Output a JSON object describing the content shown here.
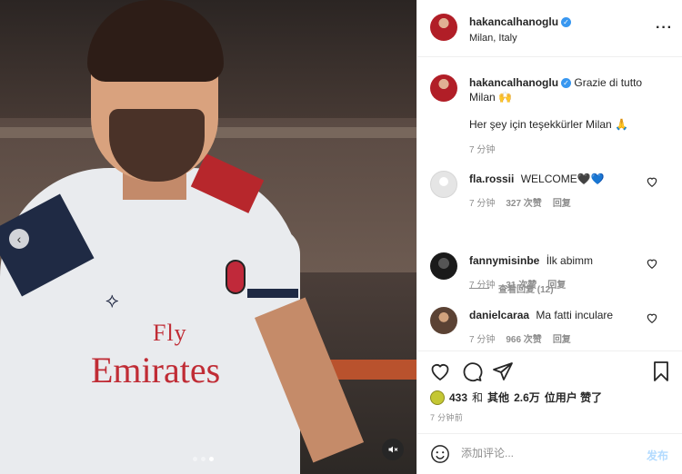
{
  "post": {
    "author": "hakancalhanoglu",
    "location": "Milan, Italy",
    "more_icon": "more-horizontal-icon"
  },
  "media": {
    "sponsor_top": "Fly",
    "sponsor_main": "Emirates",
    "dots": [
      false,
      false,
      true
    ]
  },
  "caption": {
    "username": "hakancalhanoglu",
    "text": "Grazie di tutto Milan 🙌",
    "text_line2": "Her şey için teşekkürler Milan 🙏",
    "time": "7 分钟"
  },
  "comments": [
    {
      "username": "fla.rossii",
      "text": "WELCOME🖤💙",
      "time": "7 分钟",
      "likes": "327 次赞",
      "reply": "回复"
    },
    {
      "username": "fannymisinbe",
      "text": "İlk abimm",
      "time": "7 分钟",
      "likes": "31 次赞",
      "reply": "回复"
    },
    {
      "username": "danielcaraa",
      "text": "Ma fatti inculare",
      "time": "7 分钟",
      "likes": "966 次赞",
      "reply": "回复"
    }
  ],
  "view_replies": "查看回复 (12)",
  "likes": {
    "count": "433",
    "connector": "和",
    "others_label": "其他",
    "others_count": "2.6万",
    "suffix": "位用户 赞了"
  },
  "post_time": "7 分钟前",
  "add_comment": {
    "placeholder": "添加评论...",
    "post_label": "发布"
  },
  "colors": {
    "verified": "#3897f0",
    "muted_text": "#8e8e8e",
    "post_button": "#b3dbff"
  }
}
